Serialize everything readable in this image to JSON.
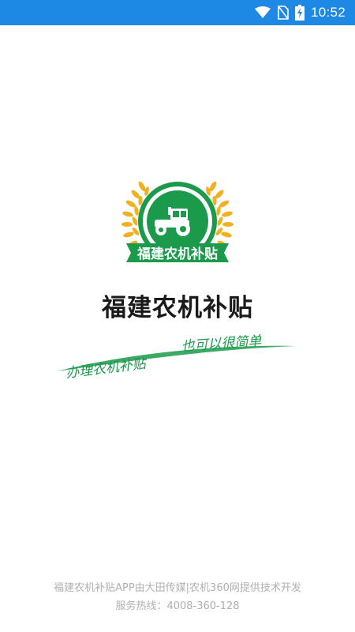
{
  "status_bar": {
    "time": "10:52",
    "background_color": "#1e88e5",
    "icons": [
      "wifi-icon",
      "no-sim-icon",
      "battery-charging-icon"
    ]
  },
  "splash": {
    "logo": {
      "badge_text": "福建农机补贴",
      "icon": "tractor-icon",
      "green": "#1a9a4a",
      "gold": "#f0b020"
    },
    "title": "福建农机补贴",
    "slogan_left": "办理农机补贴",
    "slogan_right": "也可以很简单"
  },
  "footer": {
    "line1": "福建农机补贴APP由大田传媒|农机360网提供技术开发",
    "line2": "服务热线：4008-360-128"
  }
}
